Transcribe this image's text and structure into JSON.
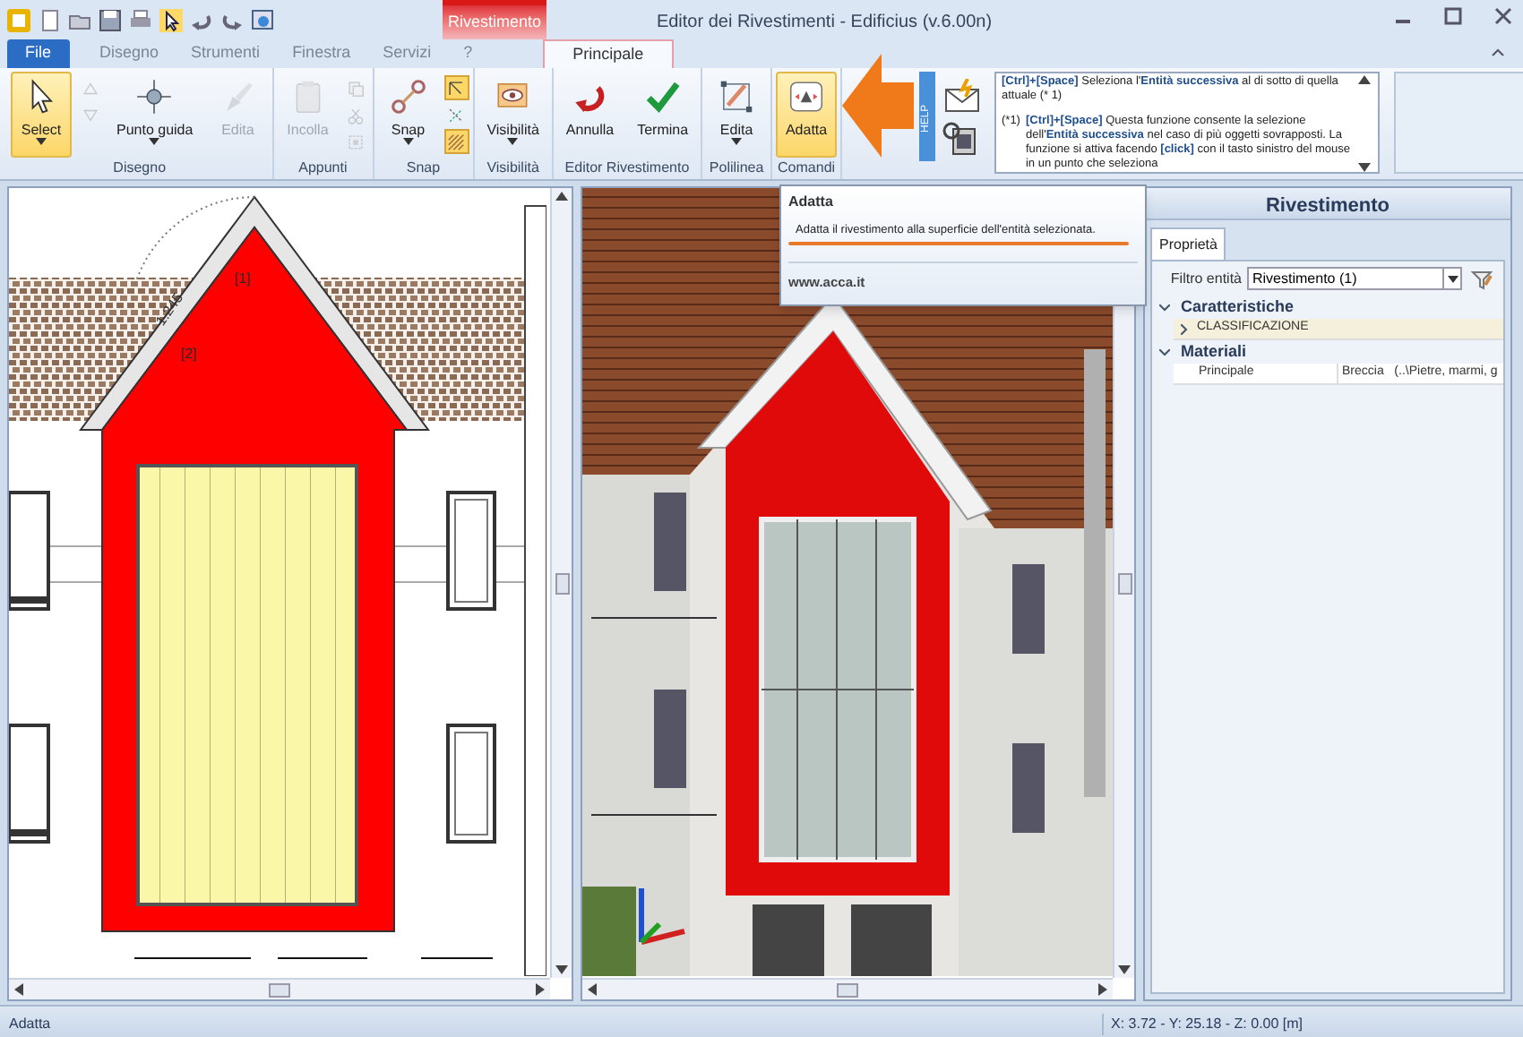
{
  "window": {
    "title": "Editor dei Rivestimenti - Edificius (v.6.00n)",
    "context_tab": "Rivestimento"
  },
  "menu_tabs": [
    {
      "label": "File",
      "kind": "file",
      "selected": false
    },
    {
      "label": "Disegno",
      "kind": "tab",
      "selected": false
    },
    {
      "label": "Strumenti",
      "kind": "tab",
      "selected": false
    },
    {
      "label": "Finestra",
      "kind": "tab",
      "selected": false
    },
    {
      "label": "Servizi",
      "kind": "tab",
      "selected": false
    },
    {
      "label": "?",
      "kind": "tab",
      "selected": false
    },
    {
      "label": "Principale",
      "kind": "context",
      "selected": true
    }
  ],
  "ribbon_groups": [
    {
      "label": "Disegno",
      "buttons": [
        {
          "label": "Select",
          "dropdown": true,
          "selected": true,
          "disabled": false
        },
        {
          "label": "Punto guida",
          "dropdown": true,
          "selected": false,
          "disabled": false
        },
        {
          "label": "Edita",
          "dropdown": false,
          "selected": false,
          "disabled": true
        }
      ],
      "small_tools": [
        {
          "selected": false,
          "disabled": true
        },
        {
          "selected": false,
          "disabled": true
        }
      ]
    },
    {
      "label": "Appunti",
      "buttons": [
        {
          "label": "Incolla",
          "dropdown": false,
          "selected": false,
          "disabled": true
        }
      ],
      "small_tools": [
        {
          "selected": false,
          "disabled": true
        },
        {
          "selected": false,
          "disabled": true
        },
        {
          "selected": false,
          "disabled": true
        }
      ]
    },
    {
      "label": "Snap",
      "buttons": [
        {
          "label": "Snap",
          "dropdown": true,
          "selected": false,
          "disabled": false
        }
      ],
      "small_tools": [
        {
          "selected": true,
          "disabled": false
        },
        {
          "selected": false,
          "disabled": false
        },
        {
          "selected": true,
          "disabled": false
        }
      ]
    },
    {
      "label": "Visibilità",
      "buttons": [
        {
          "label": "Visibilità",
          "dropdown": true,
          "selected": false,
          "disabled": false
        }
      ]
    },
    {
      "label": "Editor Rivestimento",
      "buttons": [
        {
          "label": "Annulla",
          "dropdown": false,
          "selected": false,
          "disabled": false
        },
        {
          "label": "Termina",
          "dropdown": false,
          "selected": false,
          "disabled": false
        }
      ]
    },
    {
      "label": "Polilinea",
      "buttons": [
        {
          "label": "Edita",
          "dropdown": true,
          "selected": false,
          "disabled": false
        }
      ]
    },
    {
      "label": "Comandi",
      "buttons": [
        {
          "label": "Adatta",
          "dropdown": false,
          "selected": true,
          "disabled": false
        }
      ]
    }
  ],
  "help": {
    "tab": "HELP",
    "entries": [
      {
        "text": "**[Ctrl]+[Space]** Seleziona l'**Entità successiva** al di sotto di quella attuale (* 1)"
      },
      {
        "note": "(*1)",
        "text": "**[Ctrl]+[Space]** Questa funzione consente la selezione dell'**Entità successiva** nel caso di più oggetti sovrapposti. La funzione si attiva facendo **[click]** con il tasto sinistro del mouse in un punto che seleziona"
      }
    ]
  },
  "plan_view": {
    "labels": [
      "[1]",
      "[2]",
      "1.245"
    ]
  },
  "tooltip": {
    "title": "Adatta",
    "text": "Adatta il rivestimento alla superficie dell'entità selezionata.",
    "footer": "www.acca.it"
  },
  "properties_panel": {
    "title": "Rivestimento",
    "tab": "Proprietà",
    "filter_label": "Filtro entità",
    "filter_value": "Rivestimento (1)",
    "sections": [
      {
        "label": "Caratteristiche",
        "expanded": true,
        "rows": [
          {
            "kind": "group",
            "label": "CLASSIFICAZIONE"
          }
        ]
      },
      {
        "label": "Materiali",
        "expanded": true,
        "rows": [
          {
            "kind": "property",
            "label": "Principale",
            "value": "Breccia   (..\\Pietre, marmi, g"
          }
        ]
      }
    ]
  },
  "status_bar": {
    "message": "Adatta",
    "coordinates": "X: 3.72 - Y: 25.18 - Z: 0.00 [m]"
  }
}
